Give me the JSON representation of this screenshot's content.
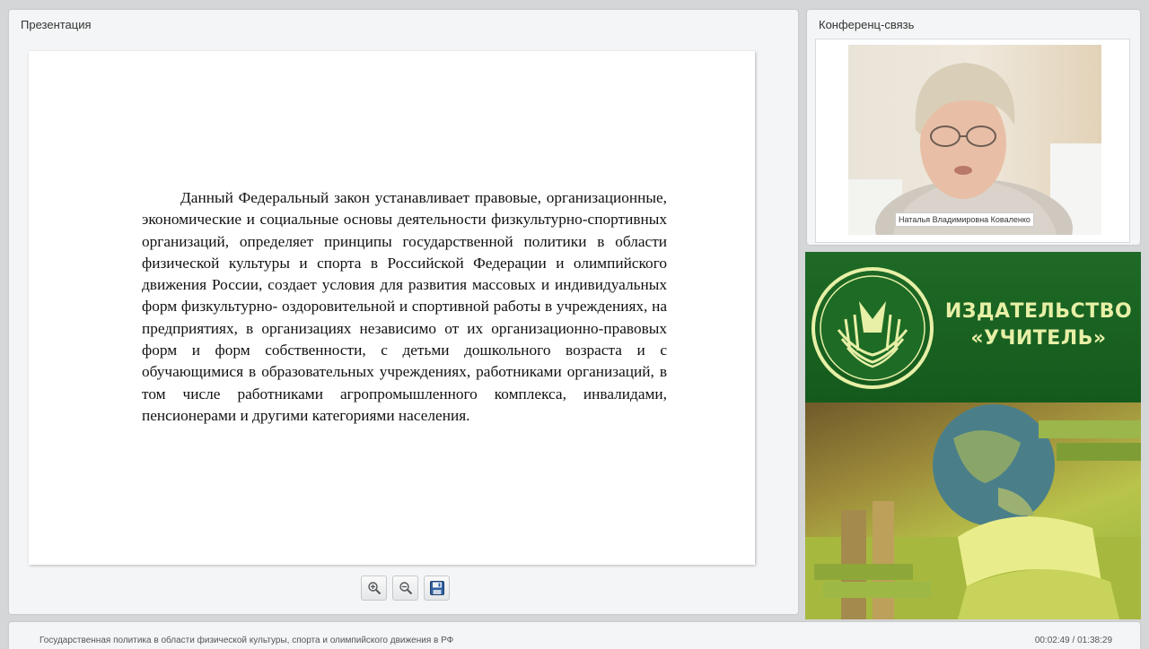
{
  "presentation": {
    "title": "Презентация",
    "slide_text": "Данный Федеральный закон устанавливает правовые, организационные, экономические и социальные основы деятельности физкультурно-спортивных организаций, определяет принципы государственной политики в области физической культуры и спорта в Российской Федерации и олимпийского движения России, создает условия для развития массовых и индивидуальных форм физкультурно- оздоровительной и спортивной работы в учреждениях, на предприятиях, в организациях независимо от их организационно-правовых форм и форм собственности, с детьми дошкольного возраста и с обучающимися в образовательных учреждениях, работниками организаций, в том числе работниками агропромышленного комплекса, инвалидами, пенсионерами и другими категориями населения.",
    "toolbar": [
      {
        "icon": "zoom-in-icon"
      },
      {
        "icon": "zoom-out-icon"
      },
      {
        "icon": "save-icon"
      }
    ]
  },
  "conference": {
    "title": "Конференц-связь",
    "participant_name": "Наталья Владимировна Коваленко"
  },
  "banner": {
    "line1": "ИЗДАТЕЛЬСТВО",
    "line2": "«УЧИТЕЛЬ»",
    "colors": {
      "green": "#1e6a26",
      "text": "#e7f0a6"
    }
  },
  "statusbar": {
    "course_title": "Государственная политика в области физической культуры, спорта и олимпийского движения в РФ",
    "time": "00:02:49 / 01:38:29"
  }
}
